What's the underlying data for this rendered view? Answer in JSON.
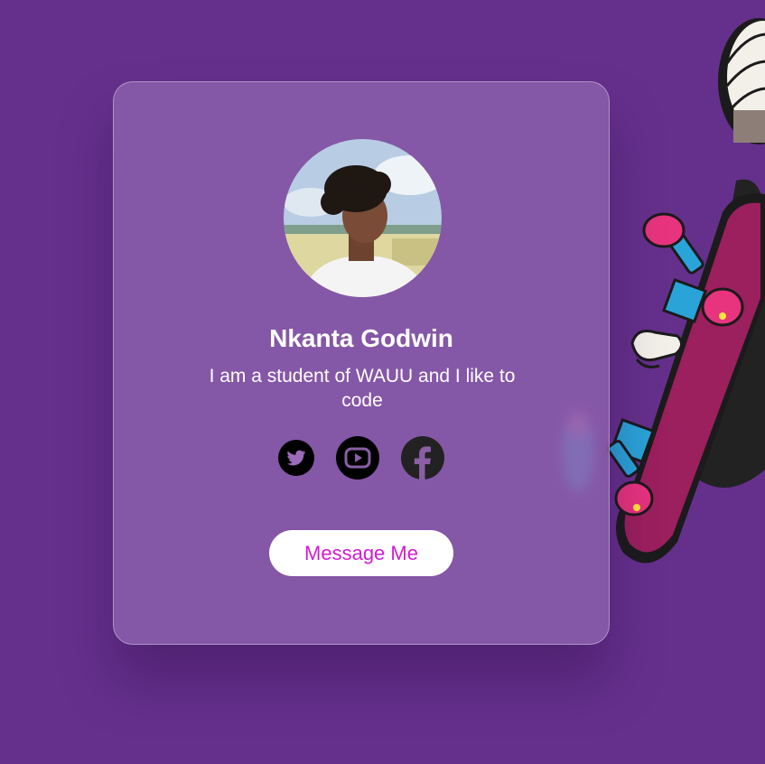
{
  "profile": {
    "name": "Nkanta Godwin",
    "bio": "I am a student of WAUU and I like to code"
  },
  "socials": [
    {
      "icon": "twitter-icon"
    },
    {
      "icon": "youtube-icon"
    },
    {
      "icon": "facebook-icon"
    }
  ],
  "actions": {
    "message_label": "Message Me"
  },
  "colors": {
    "background": "#65308c",
    "card": "#8a5fa6",
    "button_text": "#d21bd4",
    "skateboard": "#9c1f5e",
    "wheels": "#e8337e",
    "trucks": "#2aa4d8"
  }
}
